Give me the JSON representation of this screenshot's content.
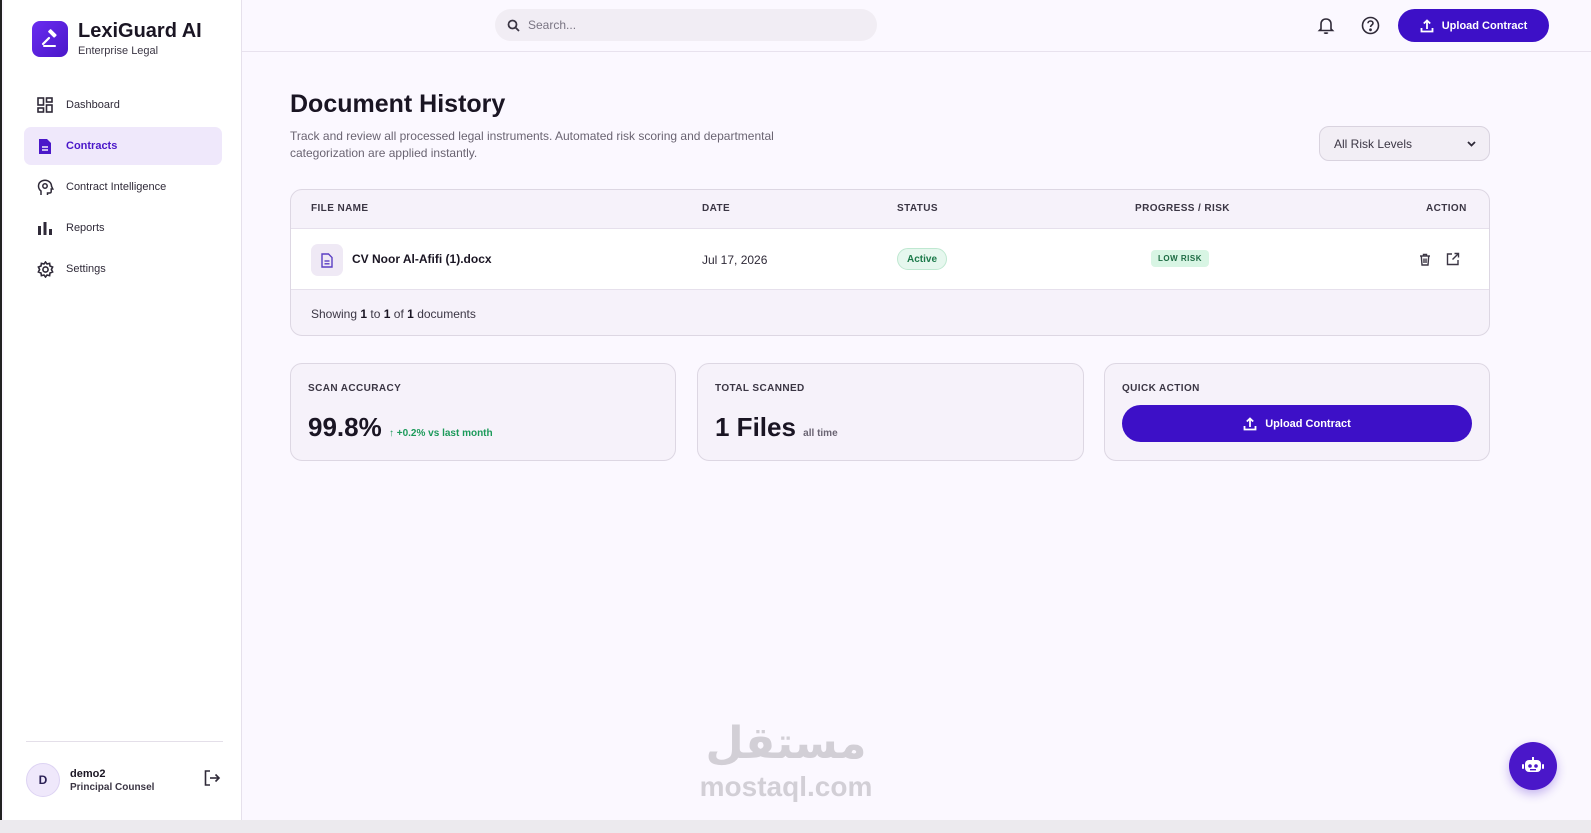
{
  "brand": {
    "name": "LexiGuard AI",
    "subtitle": "Enterprise Legal"
  },
  "sidebar": {
    "items": [
      {
        "label": "Dashboard",
        "icon": "dashboard-grid-icon",
        "active": false
      },
      {
        "label": "Contracts",
        "icon": "document-icon",
        "active": true
      },
      {
        "label": "Contract Intelligence",
        "icon": "ai-head-icon",
        "active": false
      },
      {
        "label": "Reports",
        "icon": "bar-chart-icon",
        "active": false
      },
      {
        "label": "Settings",
        "icon": "gear-icon",
        "active": false
      }
    ]
  },
  "user": {
    "initial": "D",
    "name": "demo2",
    "role": "Principal Counsel"
  },
  "header": {
    "search_placeholder": "Search...",
    "upload_label": "Upload Contract"
  },
  "page": {
    "title": "Document History",
    "description": "Track and review all processed legal instruments. Automated risk scoring and departmental categorization are applied instantly.",
    "risk_filter": "All Risk Levels"
  },
  "table": {
    "columns": [
      "FILE NAME",
      "DATE",
      "STATUS",
      "PROGRESS / RISK",
      "ACTION"
    ],
    "rows": [
      {
        "file_name": "CV Noor Al-Afifi (1).docx",
        "date": "Jul 17, 2026",
        "status": "Active",
        "risk": "LOW RISK"
      }
    ],
    "footer": {
      "prefix": "Showing",
      "from": "1",
      "to_word": "to",
      "to": "1",
      "of_word": "of",
      "total": "1",
      "suffix": "documents"
    }
  },
  "stats": {
    "scan_accuracy": {
      "label": "SCAN ACCURACY",
      "value": "99.8%",
      "delta": "+0.2% vs last month"
    },
    "total_scanned": {
      "label": "TOTAL SCANNED",
      "value": "1 Files",
      "note": "all time"
    },
    "quick_action": {
      "label": "QUICK ACTION",
      "button": "Upload Contract"
    }
  },
  "watermark": {
    "arabic": "مستقل",
    "latin": "mostaql.com"
  },
  "colors": {
    "accent": "#3d10c7",
    "active_bg": "#efe8fb",
    "success": "#1c9a5a"
  }
}
